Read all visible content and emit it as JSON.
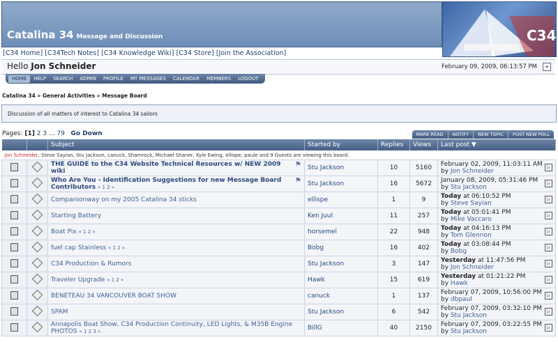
{
  "header": {
    "site_title": "Catalina 34",
    "site_subtitle": "Message and Discussion",
    "logo_text": "C34"
  },
  "top_links": [
    "[C34 Home]",
    "[C34Tech Notes]",
    "[C34 Knowledge Wiki]",
    "[C34 Store]",
    "[Join the Association]"
  ],
  "hello": {
    "prefix": "Hello",
    "user": "Jon Schneider",
    "datetime": "February 09, 2009, 06:13:57 PM"
  },
  "nav": [
    "HOME",
    "HELP",
    "SEARCH",
    "ADMIN",
    "PROFILE",
    "MY MESSAGES",
    "CALENDAR",
    "MEMBERS",
    "LOGOUT"
  ],
  "breadcrumb": "Catalina 34 » General Activities » Message Board",
  "board_description": "Discussion of all matters of interest to Catalina 34 sailors",
  "pagination": {
    "label": "Pages:",
    "current": "[1]",
    "pages": [
      "2",
      "3",
      "...",
      "79"
    ],
    "go_down": "Go Down"
  },
  "board_actions": [
    "MARK READ",
    "NOTIFY",
    "NEW TOPIC",
    "POST NEW POLL"
  ],
  "columns": {
    "subject": "Subject",
    "started_by": "Started by",
    "replies": "Replies",
    "views": "Views",
    "last_post": "Last post ▼"
  },
  "viewers": {
    "first": "Jon Schneider",
    "rest": ", Steve Sayian, Stu Jackson, canuck, Shamrock, Michael Shaner, Kyle Ewing, ellispe, paule and 9 Guests are viewing this board."
  },
  "topics": [
    {
      "subject": "THE GUIDE to the C34 Website Technical Resources w/ NEW 2009 wiki",
      "bold": true,
      "pinned": true,
      "pages": "",
      "started_by": "Stu Jackson",
      "replies": "10",
      "views": "5160",
      "last_date_bold": "",
      "last_date": "February 02, 2009, 11:03:11 AM",
      "last_by_prefix": "by",
      "last_by": "Jon Schneider"
    },
    {
      "subject": "Who Are You - Identification Suggestions for new Message Board Contributors",
      "bold": true,
      "pinned": true,
      "pages": "« 1 2 »",
      "started_by": "Stu Jackson",
      "replies": "16",
      "views": "5672",
      "last_date_bold": "",
      "last_date": "January 08, 2009, 05:31:46 PM",
      "last_by_prefix": "by",
      "last_by": "Stu Jackson"
    },
    {
      "subject": "Companionway on my 2005 Catalina 34 sticks",
      "bold": false,
      "pinned": false,
      "pages": "",
      "started_by": "ellispe",
      "replies": "1",
      "views": "9",
      "last_date_bold": "Today",
      "last_date": " at 06:10:52 PM",
      "last_by_prefix": "by",
      "last_by": "Steve Sayian"
    },
    {
      "subject": "Starting Battery",
      "bold": false,
      "pinned": false,
      "pages": "",
      "started_by": "Ken Juul",
      "replies": "11",
      "views": "257",
      "last_date_bold": "Today",
      "last_date": " at 05:01:41 PM",
      "last_by_prefix": "by",
      "last_by": "Mike Vaccaro"
    },
    {
      "subject": "Boat Pix",
      "bold": false,
      "pinned": false,
      "pages": "« 1 2 »",
      "started_by": "horsemel",
      "replies": "22",
      "views": "948",
      "last_date_bold": "Today",
      "last_date": " at 04:16:13 PM",
      "last_by_prefix": "by",
      "last_by": "Tom Glennon"
    },
    {
      "subject": "fuel cap Stainless",
      "bold": false,
      "pinned": false,
      "pages": "« 1 2 »",
      "started_by": "Bobg",
      "replies": "16",
      "views": "402",
      "last_date_bold": "Today",
      "last_date": " at 03:08:44 PM",
      "last_by_prefix": "by",
      "last_by": "Bobg"
    },
    {
      "subject": "C34 Production & Rumors",
      "bold": false,
      "pinned": false,
      "pages": "",
      "started_by": "Stu Jackson",
      "replies": "3",
      "views": "147",
      "last_date_bold": "Yesterday",
      "last_date": " at 11:47:56 PM",
      "last_by_prefix": "by",
      "last_by": "Jon Schneider"
    },
    {
      "subject": "Traveler Upgrade",
      "bold": false,
      "pinned": false,
      "pages": "« 1 2 »",
      "started_by": "Hawk",
      "replies": "15",
      "views": "619",
      "last_date_bold": "Yesterday",
      "last_date": " at 01:21:22 PM",
      "last_by_prefix": "by",
      "last_by": "Hawk"
    },
    {
      "subject": "BENETEAU 34 VANCOUVER BOAT SHOW",
      "bold": false,
      "pinned": false,
      "pages": "",
      "started_by": "canuck",
      "replies": "1",
      "views": "137",
      "last_date_bold": "",
      "last_date": "February 07, 2009, 10:56:00 PM",
      "last_by_prefix": "by",
      "last_by": "dbpaul"
    },
    {
      "subject": "SPAM",
      "bold": false,
      "pinned": false,
      "pages": "",
      "started_by": "Stu Jackson",
      "replies": "6",
      "views": "542",
      "last_date_bold": "",
      "last_date": "February 07, 2009, 03:32:10 PM",
      "last_by_prefix": "by",
      "last_by": "Stu Jackson"
    },
    {
      "subject": "Annapolis Boat Show, C34 Production Continuity, LED Lights, & M35B Engine PHOTOS",
      "bold": false,
      "pinned": false,
      "pages": "« 1 2 3 »",
      "started_by": "BillG",
      "replies": "40",
      "views": "2150",
      "last_date_bold": "",
      "last_date": "February 07, 2009, 03:22:55 PM",
      "last_by_prefix": "by",
      "last_by": "Stu Jackson"
    }
  ]
}
